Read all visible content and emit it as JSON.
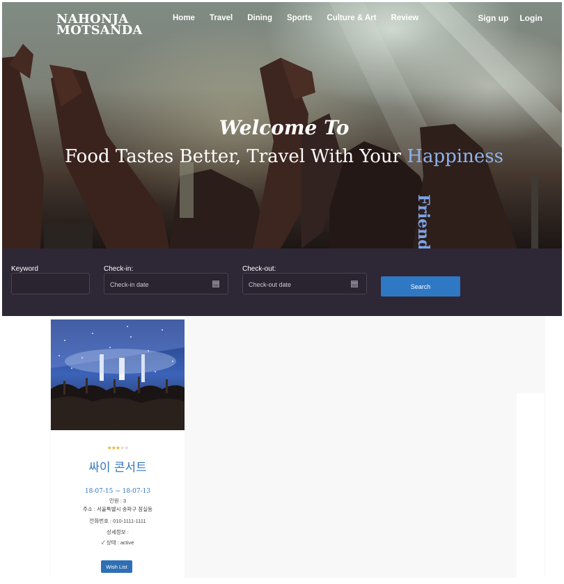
{
  "header": {
    "brand_line1": "NAHONJA",
    "brand_line2": "MOTSANDA",
    "nav": [
      {
        "label": "Home"
      },
      {
        "label": "Travel"
      },
      {
        "label": "Dining"
      },
      {
        "label": "Sports"
      },
      {
        "label": "Culture & Art"
      },
      {
        "label": "Review"
      }
    ],
    "signup_label": "Sign up",
    "login_label": "Login"
  },
  "hero": {
    "welcome": "Welcome To",
    "tagline_main": "Food Tastes Better, Travel With Your ",
    "tagline_highlight": "Happiness",
    "vertical_word": "Friend"
  },
  "search": {
    "keyword_label": "Keyword",
    "keyword_value": "",
    "checkin_label": "Check-in:",
    "checkin_placeholder": "Check-in date",
    "checkout_label": "Check-out:",
    "checkout_placeholder": "Check-out date",
    "search_button": "Search"
  },
  "card": {
    "rating": 3,
    "rating_max": 5,
    "title": "싸이 콘서트",
    "dates": "18-07-15 ~ 18-07-13",
    "people": "인원 : 3",
    "address": "주소 :  서울특별시 송파구 잠실동",
    "phone": "전화번호 :  010-1111-1111",
    "details": "상세정보 :",
    "status": "✓ 상태 : active",
    "wish_button": "Wish List"
  },
  "colors": {
    "accent": "#2f78c4",
    "search_bar_bg": "#2e2736",
    "title_blue": "#3276bf",
    "highlight_blue": "#8fb4ee",
    "star": "#f0b323"
  }
}
